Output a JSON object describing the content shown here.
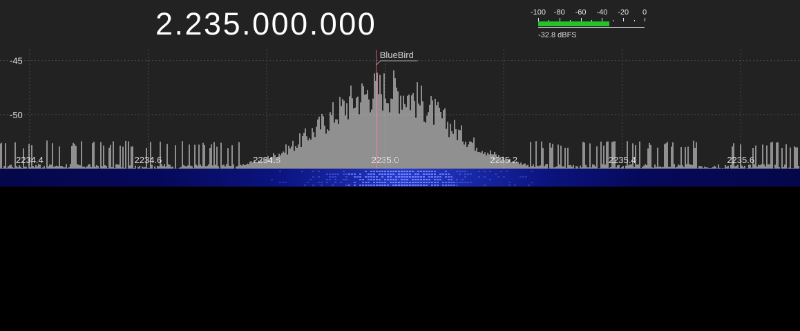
{
  "frequency_display": "2.235.000.000",
  "level_meter": {
    "scale_labels": [
      "-100",
      "-80",
      "-60",
      "-40",
      "-20",
      "0"
    ],
    "scale_min": -100,
    "scale_max": 0,
    "level_dbfs": -32.8,
    "readout": "-32.8 dBFS",
    "fill_color": "#22c427"
  },
  "spectrum": {
    "y_labels": [
      {
        "value": -45,
        "text": "-45"
      },
      {
        "value": -50,
        "text": "-50"
      }
    ],
    "y_range": [
      -55,
      -44
    ],
    "x_labels": [
      "2234.4",
      "2234.6",
      "2234.8",
      "2235.0",
      "2235.2",
      "2235.4",
      "2235.6"
    ],
    "x_range_mhz": [
      2234.35,
      2235.7
    ],
    "center_mhz": 2235.0,
    "bookmark": {
      "label": "BlueBird",
      "freq_mhz": 2234.985,
      "color": "#e0566a"
    },
    "trace_color": "#ffffff",
    "background": "#222223"
  },
  "waterfall": {
    "colors": [
      "#05074a",
      "#2a3cc8"
    ]
  }
}
